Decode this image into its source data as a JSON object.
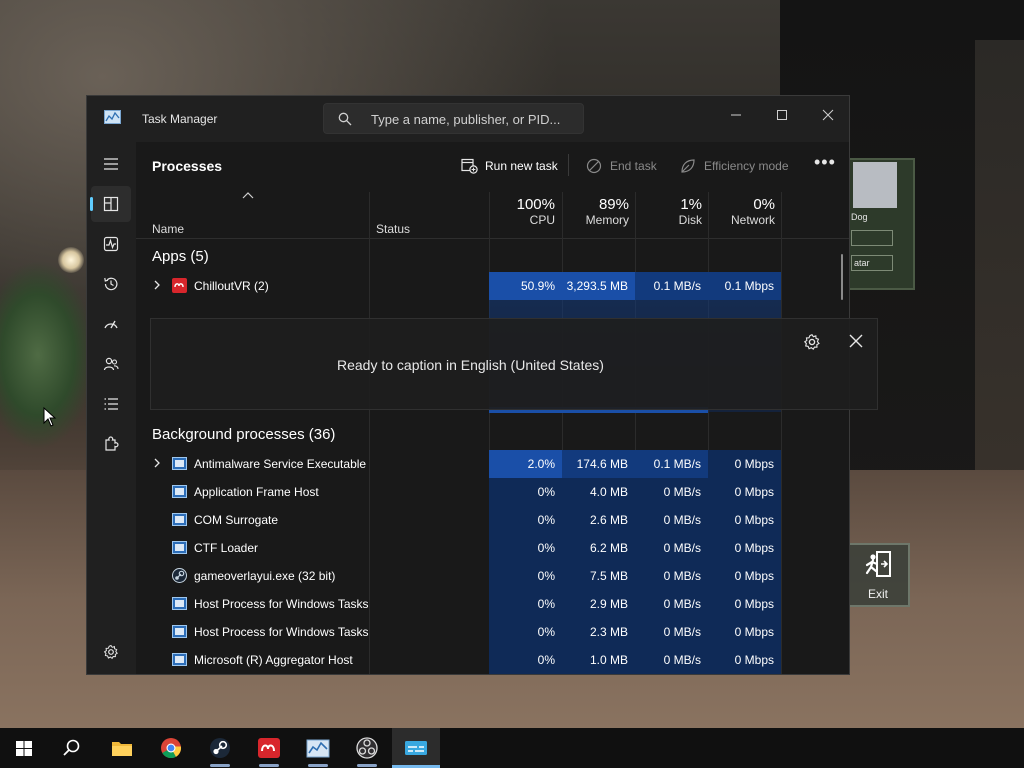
{
  "window": {
    "title": "Task Manager",
    "search_placeholder": "Type a name, publisher, or PID..."
  },
  "toolbar": {
    "heading": "Processes",
    "run_new_task": "Run new task",
    "end_task": "End task",
    "efficiency_mode": "Efficiency mode",
    "more": "•••"
  },
  "columns": {
    "name": "Name",
    "status": "Status",
    "cpu": {
      "pct": "100%",
      "label": "CPU"
    },
    "memory": {
      "pct": "89%",
      "label": "Memory"
    },
    "disk": {
      "pct": "1%",
      "label": "Disk"
    },
    "network": {
      "pct": "0%",
      "label": "Network"
    }
  },
  "groups": {
    "apps": "Apps (5)",
    "background": "Background processes (36)"
  },
  "apps": [
    {
      "name": "ChilloutVR (2)",
      "cpu": "50.9%",
      "memory": "3,293.5 MB",
      "disk": "0.1 MB/s",
      "network": "0.1 Mbps"
    }
  ],
  "background": [
    {
      "name": "Antimalware Service Executable",
      "cpu": "2.0%",
      "memory": "174.6 MB",
      "disk": "0.1 MB/s",
      "network": "0 Mbps"
    },
    {
      "name": "Application Frame Host",
      "cpu": "0%",
      "memory": "4.0 MB",
      "disk": "0 MB/s",
      "network": "0 Mbps"
    },
    {
      "name": "COM Surrogate",
      "cpu": "0%",
      "memory": "2.6 MB",
      "disk": "0 MB/s",
      "network": "0 Mbps"
    },
    {
      "name": "CTF Loader",
      "cpu": "0%",
      "memory": "6.2 MB",
      "disk": "0 MB/s",
      "network": "0 Mbps"
    },
    {
      "name": "gameoverlayui.exe (32 bit)",
      "cpu": "0%",
      "memory": "7.5 MB",
      "disk": "0 MB/s",
      "network": "0 Mbps"
    },
    {
      "name": "Host Process for Windows Tasks",
      "cpu": "0%",
      "memory": "2.9 MB",
      "disk": "0 MB/s",
      "network": "0 Mbps"
    },
    {
      "name": "Host Process for Windows Tasks",
      "cpu": "0%",
      "memory": "2.3 MB",
      "disk": "0 MB/s",
      "network": "0 Mbps"
    },
    {
      "name": "Microsoft (R) Aggregator Host",
      "cpu": "0%",
      "memory": "1.0 MB",
      "disk": "0 MB/s",
      "network": "0 Mbps"
    }
  ],
  "caption": {
    "message": "Ready to caption in English (United States)"
  },
  "scene": {
    "panel_label": "Dog",
    "panel_button": "atar",
    "exit_label": "Exit"
  },
  "colors": {
    "accent": "#60cdff",
    "heat_high": "#1a4fa8",
    "heat_low": "#0f2a57"
  }
}
